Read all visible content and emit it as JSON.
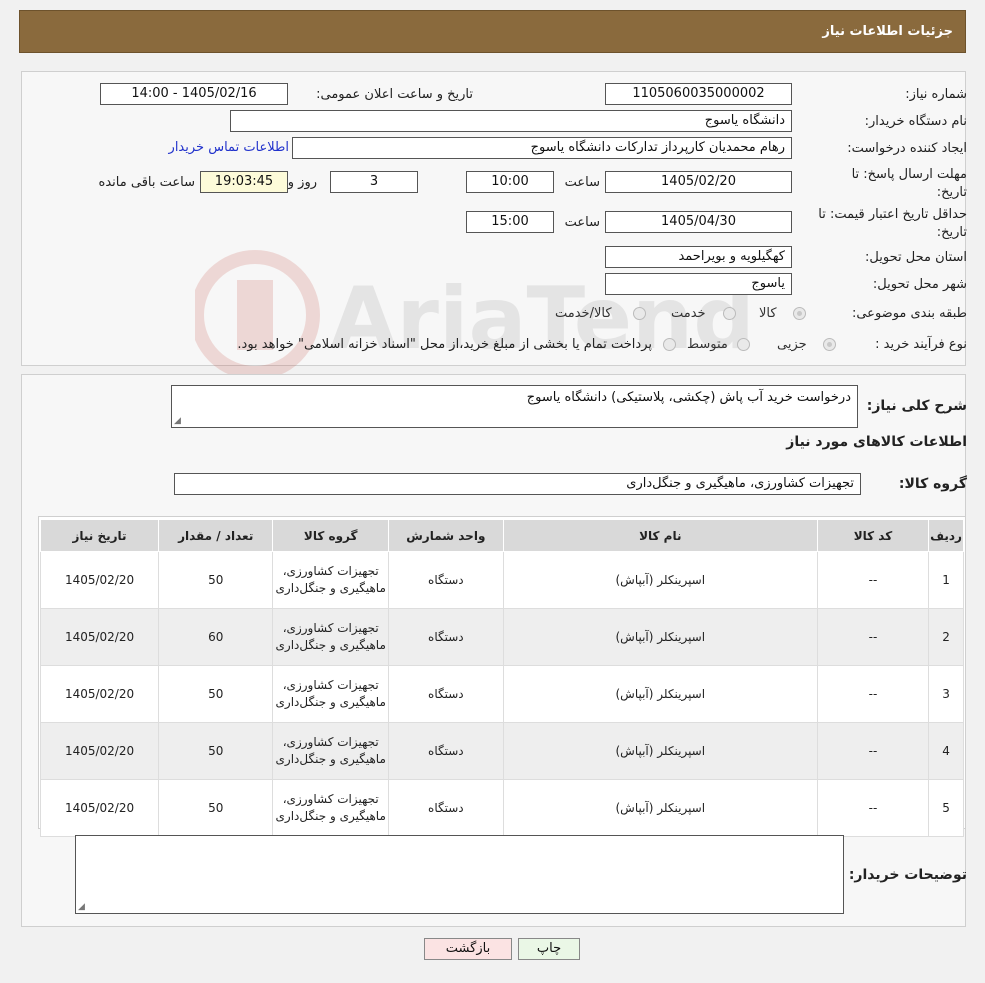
{
  "header": {
    "title": "جزئیات اطلاعات نیاز"
  },
  "form": {
    "need_number_label": "شماره نیاز:",
    "need_number": "1105060035000002",
    "announce_label": "تاریخ و ساعت اعلان عمومی:",
    "announce_value": "1405/02/16 - 14:00",
    "buyer_org_label": "نام دستگاه خریدار:",
    "buyer_org": "دانشگاه یاسوج",
    "creator_label": "ایجاد کننده درخواست:",
    "creator": "رهام محمدیان کارپرداز تدارکات دانشگاه یاسوج",
    "contact_link": "اطلاعات تماس خریدار",
    "deadline_label": "مهلت ارسال پاسخ: تا تاریخ:",
    "deadline_date": "1405/02/20",
    "time_label": "ساعت",
    "deadline_time": "10:00",
    "days": "3",
    "days_label": "روز و",
    "remaining": "19:03:45",
    "remaining_label": "ساعت باقی مانده",
    "validity_label": "حداقل تاریخ اعتبار قیمت: تا تاریخ:",
    "validity_date": "1405/04/30",
    "validity_time": "15:00",
    "province_label": "استان محل تحویل:",
    "province": "کهگیلویه و بویراحمد",
    "city_label": "شهر محل تحویل:",
    "city": "یاسوج",
    "category_label": "طبقه بندی موضوعی:",
    "category_options": [
      "کالا",
      "خدمت",
      "کالا/خدمت"
    ],
    "process_label": "نوع فرآیند خرید :",
    "process_options": [
      "جزیی",
      "متوسط"
    ],
    "process_note": "پرداخت تمام یا بخشی از مبلغ خرید،از محل \"اسناد خزانه اسلامی\" خواهد بود."
  },
  "watermark": {
    "text": "AriaTender.neT"
  },
  "summary": {
    "label": "شرح کلی نیاز:",
    "value": "درخواست خرید آب پاش (چکشی، پلاستیکی) دانشگاه یاسوج",
    "items_title": "اطلاعات کالاهای مورد نیاز",
    "group_label": "گروه کالا:",
    "group_value": "تجهیزات کشاورزی، ماهیگیری و جنگل‌داری"
  },
  "table": {
    "headers": [
      "ردیف",
      "کد کالا",
      "نام کالا",
      "واحد شمارش",
      "گروه کالا",
      "تعداد / مقدار",
      "تاریخ نیاز"
    ],
    "rows": [
      [
        "1",
        "--",
        "اسپرینکلر (آبپاش)",
        "دستگاه",
        "تجهیزات کشاورزی، ماهیگیری و جنگل‌داری",
        "50",
        "1405/02/20"
      ],
      [
        "2",
        "--",
        "اسپرینکلر (آبپاش)",
        "دستگاه",
        "تجهیزات کشاورزی، ماهیگیری و جنگل‌داری",
        "60",
        "1405/02/20"
      ],
      [
        "3",
        "--",
        "اسپرینکلر (آبپاش)",
        "دستگاه",
        "تجهیزات کشاورزی، ماهیگیری و جنگل‌داری",
        "50",
        "1405/02/20"
      ],
      [
        "4",
        "--",
        "اسپرینکلر (آبپاش)",
        "دستگاه",
        "تجهیزات کشاورزی، ماهیگیری و جنگل‌داری",
        "50",
        "1405/02/20"
      ],
      [
        "5",
        "--",
        "اسپرینکلر (آبپاش)",
        "دستگاه",
        "تجهیزات کشاورزی، ماهیگیری و جنگل‌داری",
        "50",
        "1405/02/20"
      ]
    ]
  },
  "buyer_notes": {
    "label": "توضیحات خریدار:",
    "value": ""
  },
  "buttons": {
    "print": "چاپ",
    "back": "بازگشت"
  },
  "colors": {
    "header_bg": "#8a6a3d",
    "link": "#2233cc",
    "back_button_bg": "#fbe3e3",
    "print_button_bg": "#eaf7e6"
  }
}
